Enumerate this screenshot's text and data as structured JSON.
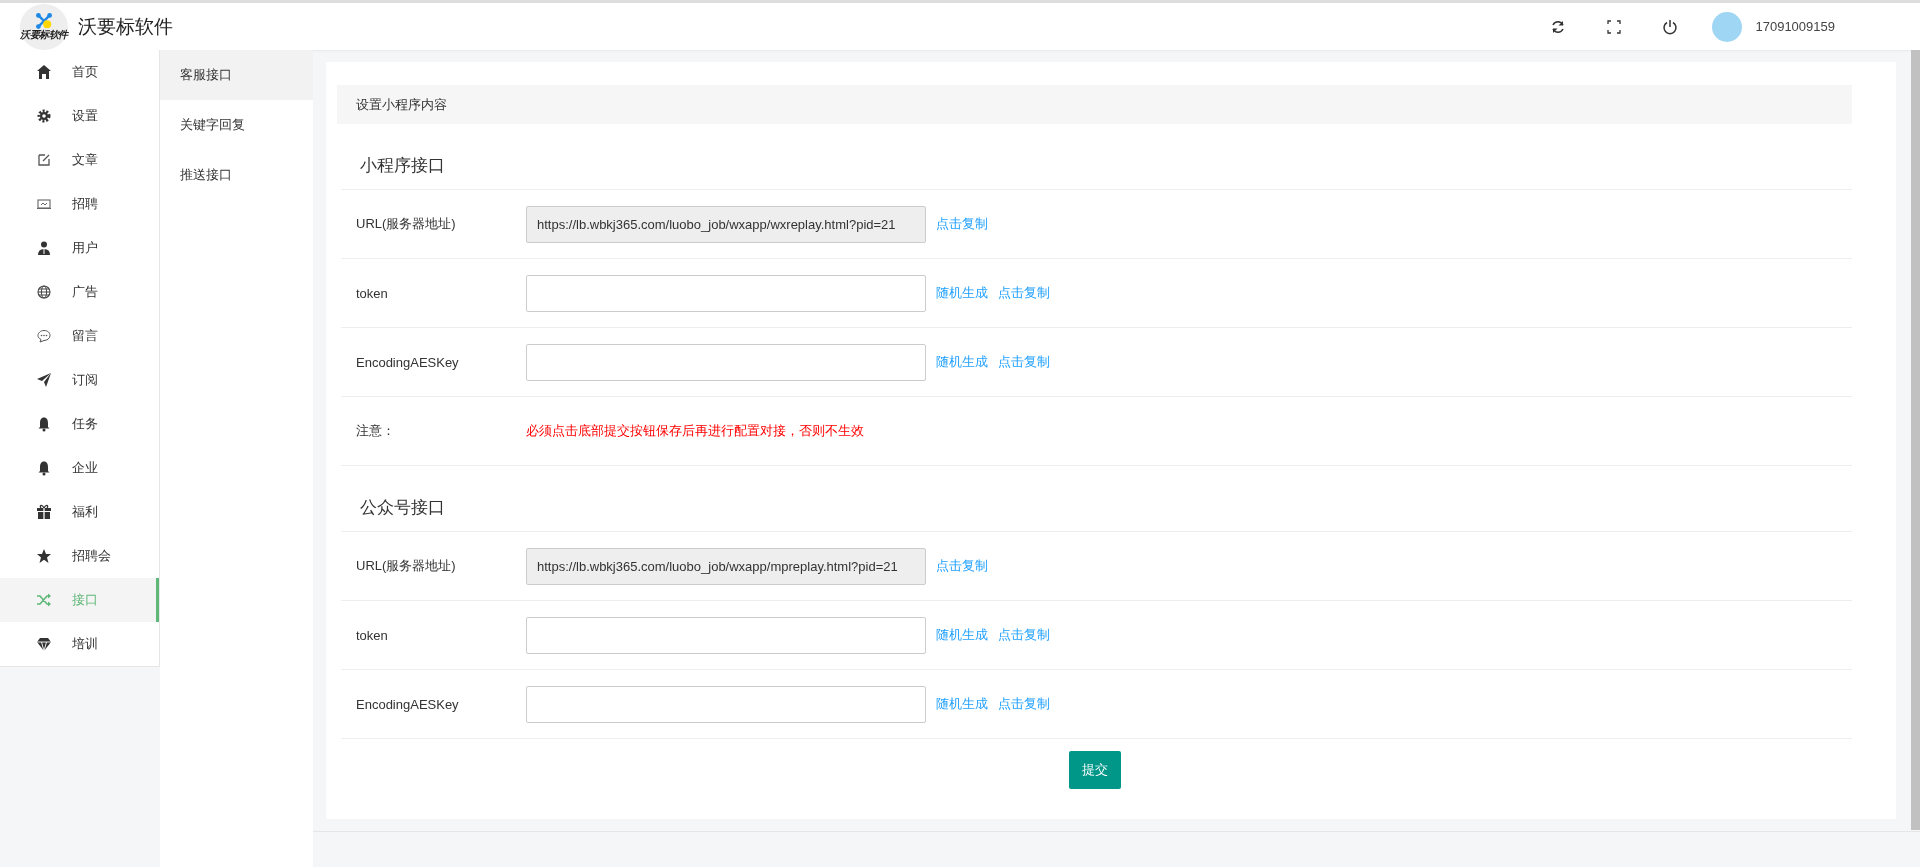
{
  "header": {
    "logo_text": "沃要标软件",
    "title": "沃要标软件",
    "username": "17091009159"
  },
  "sidebar": {
    "items": [
      {
        "label": "首页",
        "selected": false
      },
      {
        "label": "设置",
        "selected": false
      },
      {
        "label": "文章",
        "selected": false
      },
      {
        "label": "招聘",
        "selected": false
      },
      {
        "label": "用户",
        "selected": false
      },
      {
        "label": "广告",
        "selected": false
      },
      {
        "label": "留言",
        "selected": false
      },
      {
        "label": "订阅",
        "selected": false
      },
      {
        "label": "任务",
        "selected": false
      },
      {
        "label": "企业",
        "selected": false
      },
      {
        "label": "福利",
        "selected": false
      },
      {
        "label": "招聘会",
        "selected": false
      },
      {
        "label": "接口",
        "selected": true
      },
      {
        "label": "培训",
        "selected": false
      }
    ]
  },
  "subnav": {
    "items": [
      {
        "label": "客服接口",
        "selected": true
      },
      {
        "label": "关键字回复",
        "selected": false
      },
      {
        "label": "推送接口",
        "selected": false
      }
    ]
  },
  "panel": {
    "heading": "设置小程序内容",
    "sections": [
      {
        "title": "小程序接口",
        "rows": [
          {
            "kind": "readonly",
            "label": "URL(服务器地址)",
            "value": "https://lb.wbkj365.com/luobo_job/wxapp/wxreplay.html?pid=21",
            "links": [
              "点击复制"
            ]
          },
          {
            "kind": "input",
            "label": "token",
            "links": [
              "随机生成",
              "点击复制"
            ]
          },
          {
            "kind": "input",
            "label": "EncodingAESKey",
            "links": [
              "随机生成",
              "点击复制"
            ]
          },
          {
            "kind": "note",
            "label": "注意：",
            "text": "必须点击底部提交按钮保存后再进行配置对接，否则不生效"
          }
        ]
      },
      {
        "title": "公众号接口",
        "rows": [
          {
            "kind": "readonly",
            "label": "URL(服务器地址)",
            "value": "https://lb.wbkj365.com/luobo_job/wxapp/mpreplay.html?pid=21",
            "links": [
              "点击复制"
            ]
          },
          {
            "kind": "input",
            "label": "token",
            "links": [
              "随机生成",
              "点击复制"
            ]
          },
          {
            "kind": "input",
            "label": "EncodingAESKey",
            "links": [
              "随机生成",
              "点击复制"
            ]
          }
        ]
      }
    ],
    "submit": "提交"
  }
}
